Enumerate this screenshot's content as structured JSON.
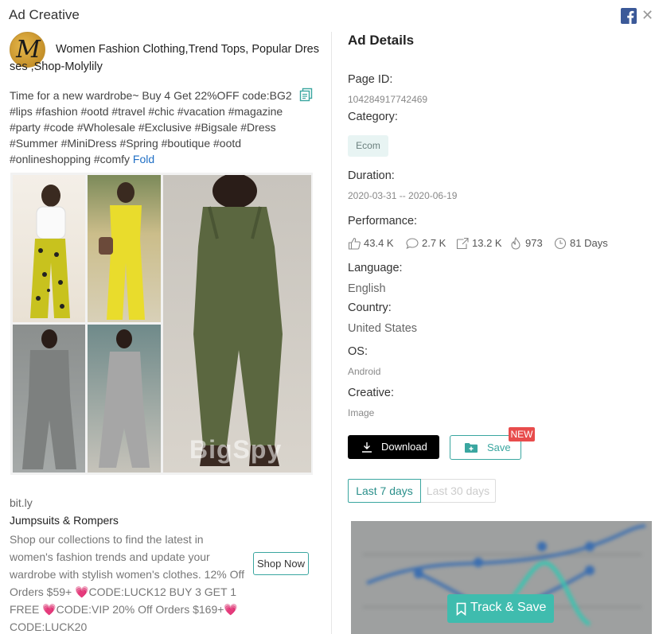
{
  "header": {
    "title": "Ad Creative"
  },
  "ad": {
    "advertiser_initial": "M",
    "title": "Women Fashion Clothing,Trend Tops, Popular Dresses ,Shop-Molylily",
    "text": "Time for a new wardrobe~ Buy 4 Get 22%OFF code:BG2 #lips #fashion #ootd #travel #chic #vacation #magazine #party #code #Wholesale #Exclusive #Bigsale #Dress #Summer #MiniDress #Spring #boutique #ootd #onlineshopping #comfy",
    "fold_label": "Fold",
    "watermark": "BigSpy",
    "link_domain": "bit.ly",
    "link_title": "Jumpsuits & Rompers",
    "link_description": "Shop our collections to find the latest in women's fashion trends and update your wardrobe with stylish women's clothes. 12% Off Orders $59+ 💗CODE:LUCK12 BUY 3 GET 1 FREE 💗CODE:VIP 20% Off Orders $169+💗 CODE:LUCK20",
    "cta_label": "Shop Now"
  },
  "details": {
    "heading": "Ad Details",
    "page_id_label": "Page ID:",
    "page_id": "104284917742469",
    "category_label": "Category:",
    "category": "Ecom",
    "duration_label": "Duration:",
    "duration": "2020-03-31 -- 2020-06-19",
    "performance_label": "Performance:",
    "performance": {
      "likes": "43.4 K",
      "comments": "2.7 K",
      "shares": "13.2 K",
      "hot": "973",
      "days": "81 Days"
    },
    "language_label": "Language:",
    "language": "English",
    "country_label": "Country:",
    "country": "United States",
    "os_label": "OS:",
    "os": "Android",
    "creative_label": "Creative:",
    "creative": "Image"
  },
  "actions": {
    "download_label": "Download",
    "save_label": "Save",
    "new_badge": "NEW"
  },
  "range_tabs": {
    "last7": "Last 7 days",
    "last30": "Last 30 days"
  },
  "track_save_label": "Track & Save",
  "colors": {
    "accent": "#3aa6a0",
    "track_button": "#3fbcae",
    "badge": "#e84c4c",
    "facebook": "#3b5998"
  }
}
